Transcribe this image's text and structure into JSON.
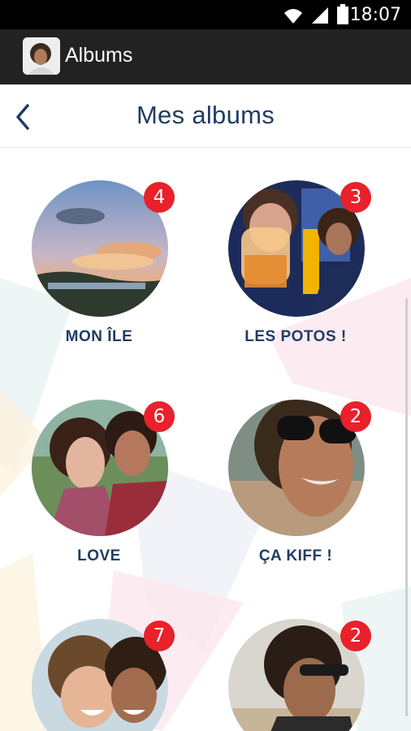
{
  "status_bar": {
    "time": "18:07"
  },
  "action_bar": {
    "title": "Albums"
  },
  "header": {
    "title": "Mes albums"
  },
  "albums": [
    {
      "label": "MON ÎLE",
      "count": "4"
    },
    {
      "label": "LES POTOS !",
      "count": "3"
    },
    {
      "label": "LOVE",
      "count": "6"
    },
    {
      "label": "ÇA KIFF !",
      "count": "2"
    },
    {
      "label": "",
      "count": "7"
    },
    {
      "label": "",
      "count": "2"
    }
  ],
  "colors": {
    "badge": "#e8212b",
    "title": "#1f3d63",
    "action_bar": "#222222"
  }
}
